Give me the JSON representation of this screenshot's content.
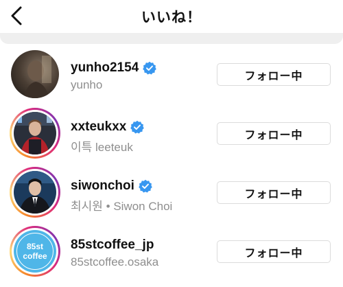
{
  "header": {
    "title": "いいね！",
    "back_icon": "chevron-left-icon"
  },
  "colors": {
    "verified": "#3897f0",
    "secondary_text": "#8e8e8e",
    "button_border": "#dbdbdb",
    "story_ring_start": "#f58529",
    "story_ring_end": "#dd2a7b"
  },
  "users": [
    {
      "username": "yunho2154",
      "subname": "yunho",
      "verified": true,
      "has_story": false,
      "follow_label": "フォロー中"
    },
    {
      "username": "xxteukxx",
      "subname": "이특 leeteuk",
      "verified": true,
      "has_story": true,
      "follow_label": "フォロー中"
    },
    {
      "username": "siwonchoi",
      "subname": "최시원 • Siwon Choi",
      "verified": true,
      "has_story": true,
      "follow_label": "フォロー中"
    },
    {
      "username": "85stcoffee_jp",
      "subname": "85stcoffee.osaka",
      "verified": false,
      "has_story": true,
      "follow_label": "フォロー中",
      "avatar_text_line1": "85st",
      "avatar_text_line2": "coffee"
    }
  ]
}
